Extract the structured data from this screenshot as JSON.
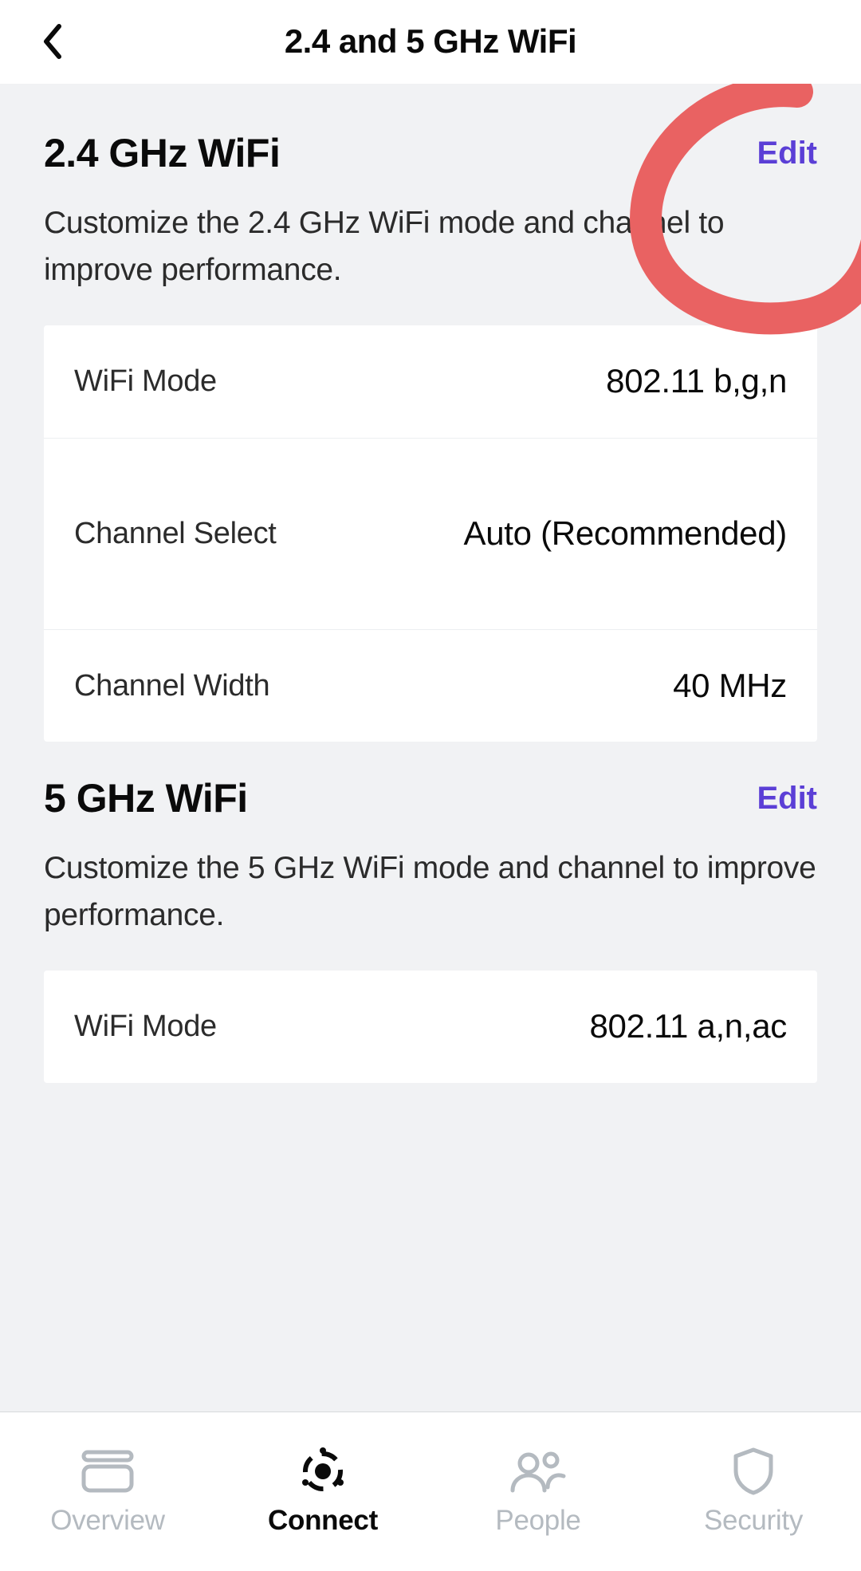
{
  "header": {
    "title": "2.4 and 5 GHz WiFi"
  },
  "sections": {
    "g24": {
      "title": "2.4 GHz WiFi",
      "edit": "Edit",
      "desc": "Customize the 2.4 GHz WiFi mode and channel to improve performance.",
      "rows": {
        "mode": {
          "label": "WiFi Mode",
          "value": "802.11 b,g,n"
        },
        "chsel": {
          "label": "Channel Select",
          "value": "Auto (Recommended)"
        },
        "chw": {
          "label": "Channel Width",
          "value": "40 MHz"
        }
      }
    },
    "g5": {
      "title": "5 GHz WiFi",
      "edit": "Edit",
      "desc": "Customize the 5 GHz WiFi mode and channel to improve performance.",
      "rows": {
        "mode": {
          "label": "WiFi Mode",
          "value": "802.11 a,n,ac"
        }
      }
    }
  },
  "nav": {
    "overview": "Overview",
    "connect": "Connect",
    "people": "People",
    "security": "Security"
  },
  "colors": {
    "link": "#5b3fd6",
    "annotation": "#e96262"
  }
}
